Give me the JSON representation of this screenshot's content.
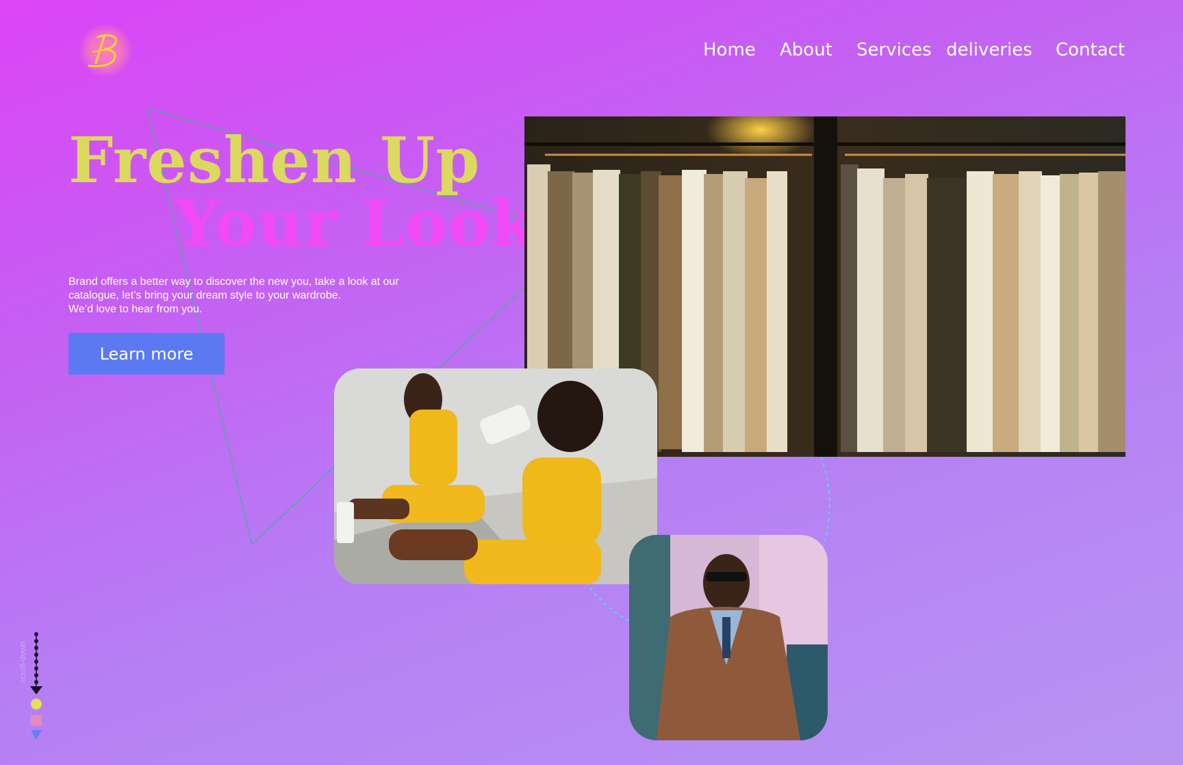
{
  "brand": {
    "logo_icon": "brand-b-logo-icon",
    "logo_letter": "B"
  },
  "nav": {
    "items": [
      {
        "label": "Home"
      },
      {
        "label": "About"
      },
      {
        "label": "Services"
      },
      {
        "label": "deliveries"
      },
      {
        "label": "Contact"
      }
    ]
  },
  "hero": {
    "headline_line1": "Freshen Up",
    "headline_line2": "Your Look",
    "intro_lines": [
      "Brand offers a better way to discover the new you,  take a look at our",
      "catalogue, let’s bring your dream style to your wardrobe.",
      "We’d love to hear from you."
    ],
    "cta_label": "Learn more"
  },
  "images": {
    "clothing_rack": "clothing-rack-photo",
    "athletes": "athletes-photo",
    "man_in_jacket": "man-in-leather-jacket-photo"
  },
  "scroll": {
    "label": "scroll-down",
    "markers": [
      "yellow-circle",
      "pink-square",
      "blue-triangle"
    ]
  },
  "colors": {
    "headline_yellow": "#dcd960",
    "headline_pink": "#f24af7",
    "cta_blue": "#5b7af1",
    "marker_yellow": "#e4df55",
    "marker_pink": "#e78ab8",
    "marker_blue": "#6a7ef0",
    "dashed_circle": "#4fd9e8",
    "triangle_line": "#5aa3a8"
  }
}
